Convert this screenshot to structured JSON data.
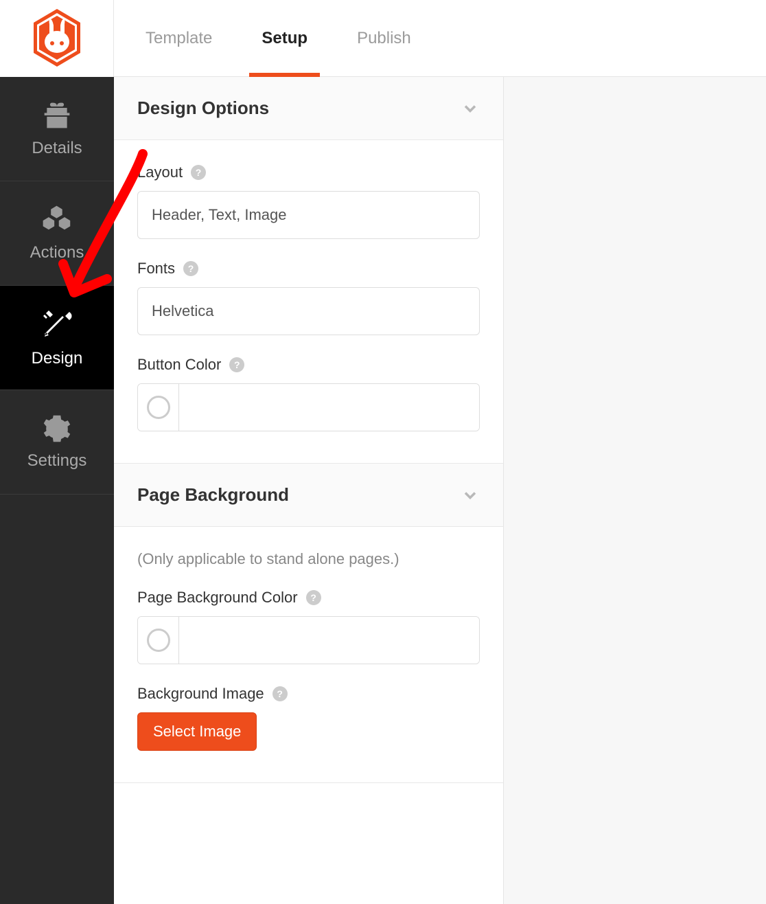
{
  "tabs": {
    "template": "Template",
    "setup": "Setup",
    "publish": "Publish"
  },
  "sidebar": {
    "items": [
      {
        "label": "Details"
      },
      {
        "label": "Actions"
      },
      {
        "label": "Design"
      },
      {
        "label": "Settings"
      }
    ]
  },
  "sections": {
    "designOptions": {
      "title": "Design Options",
      "layout": {
        "label": "Layout",
        "value": "Header, Text, Image"
      },
      "fonts": {
        "label": "Fonts",
        "value": "Helvetica"
      },
      "buttonColor": {
        "label": "Button Color",
        "value": ""
      }
    },
    "pageBackground": {
      "title": "Page Background",
      "note": "(Only applicable to stand alone pages.)",
      "bgColor": {
        "label": "Page Background Color",
        "value": ""
      },
      "bgImage": {
        "label": "Background Image",
        "button": "Select Image"
      }
    }
  },
  "colors": {
    "accent": "#ee4d1c"
  }
}
